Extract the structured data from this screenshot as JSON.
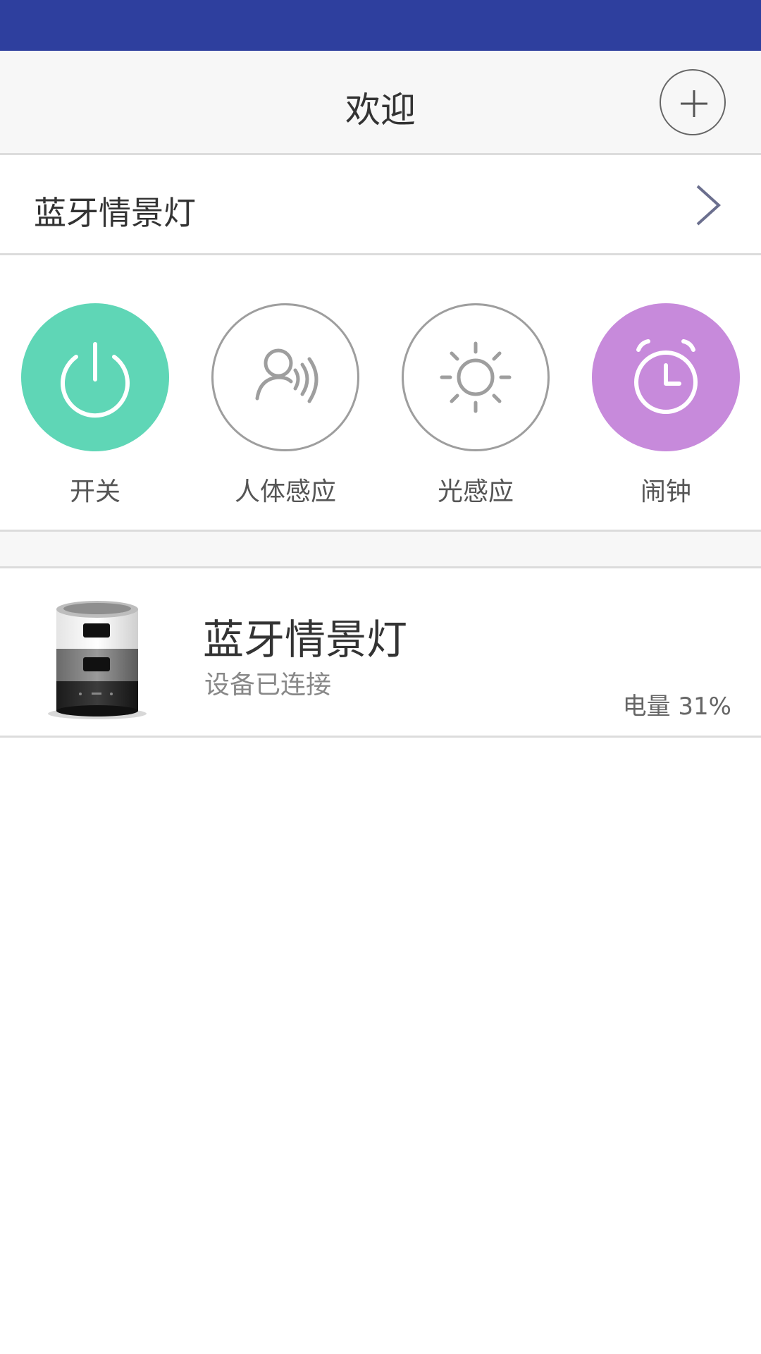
{
  "header": {
    "title": "欢迎",
    "add_icon": "plus-circle-icon"
  },
  "device_row": {
    "label": "蓝牙情景灯",
    "chevron_icon": "chevron-right-icon"
  },
  "functions": [
    {
      "label": "开关",
      "icon": "power-icon",
      "active": true,
      "color": "#5fd6b6"
    },
    {
      "label": "人体感应",
      "icon": "person-sensor-icon",
      "active": false,
      "color": "#9e9e9e"
    },
    {
      "label": "光感应",
      "icon": "sun-icon",
      "active": false,
      "color": "#9e9e9e"
    },
    {
      "label": "闹钟",
      "icon": "alarm-clock-icon",
      "active": true,
      "color": "#c78adb"
    }
  ],
  "device_card": {
    "name": "蓝牙情景灯",
    "status": "设备已连接",
    "battery": "电量 31%"
  },
  "colors": {
    "status_bar": "#2e3f9e",
    "accent_green": "#5fd6b6",
    "accent_purple": "#c78adb"
  }
}
